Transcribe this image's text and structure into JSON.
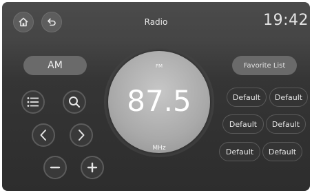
{
  "header": {
    "title": "Radio",
    "clock": "19:42",
    "home_icon": "home-icon",
    "back_icon": "back-icon"
  },
  "band_toggle": {
    "label": "AM"
  },
  "favorite_list": {
    "label": "Favorite List"
  },
  "tuner": {
    "band": "FM",
    "frequency": "87.5",
    "unit": "MHz"
  },
  "controls": [
    {
      "name": "list-icon"
    },
    {
      "name": "search-icon"
    },
    {
      "name": "chevron-left-icon"
    },
    {
      "name": "chevron-right-icon"
    },
    {
      "name": "minus-icon"
    },
    {
      "name": "plus-icon"
    }
  ],
  "presets": [
    {
      "label": "Default"
    },
    {
      "label": "Default"
    },
    {
      "label": "Default"
    },
    {
      "label": "Default"
    },
    {
      "label": "Default"
    },
    {
      "label": "Default"
    }
  ],
  "colors": {
    "background": "#3a3a3a",
    "dial": "#a9a9a9",
    "text": "#ffffff"
  }
}
